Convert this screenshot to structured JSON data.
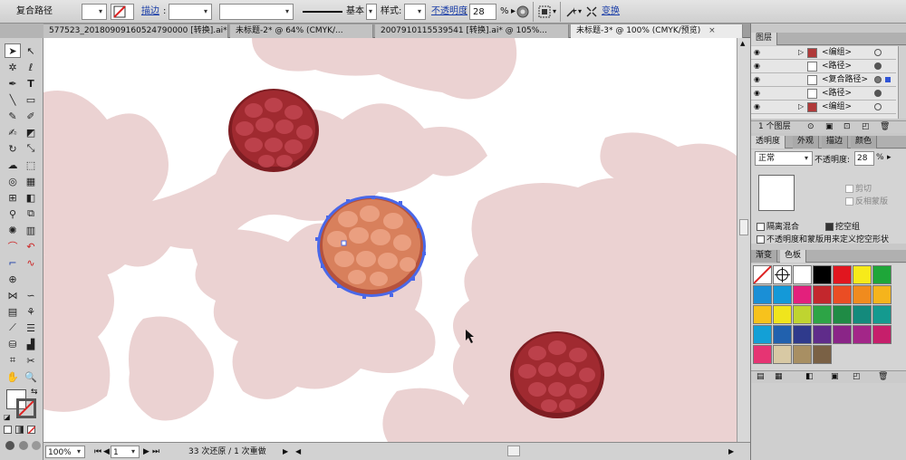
{
  "control_bar": {
    "selection_label": "复合路径",
    "stroke_label": "描边",
    "stroke_style": "基本",
    "style_label": "样式:",
    "opacity_label": "不透明度",
    "opacity_value": "28",
    "opacity_unit": "%",
    "transform_label": "变换"
  },
  "tabs": [
    {
      "label": "577523_20180909160524790000 [转换].ai*",
      "active": false
    },
    {
      "label": "未标题-2* @ 64% (CMYK/...",
      "active": false
    },
    {
      "label": "2007910115539541 [转换].ai* @ 105%...",
      "active": false
    },
    {
      "label": "未标题-3* @ 100% (CMYK/预览)",
      "active": true
    }
  ],
  "status_bar": {
    "zoom": "100%",
    "page": "1",
    "history": "33 次还原 / 1 次重做"
  },
  "layers_panel": {
    "title": "图层",
    "rows": [
      {
        "label": "<编组>",
        "has_arrow": true,
        "thumb": "red"
      },
      {
        "label": "<路径>",
        "has_arrow": false,
        "thumb": "white"
      },
      {
        "label": "<复合路径>",
        "has_arrow": false,
        "thumb": "white"
      },
      {
        "label": "<路径>",
        "has_arrow": false,
        "thumb": "white"
      },
      {
        "label": "<编组>",
        "has_arrow": true,
        "thumb": "red"
      }
    ],
    "footer_count": "1 个图层"
  },
  "transparency_panel": {
    "tabs": [
      "透明度",
      "外观",
      "描边",
      "颜色"
    ],
    "blend_mode": "正常",
    "opacity_label": "不透明度:",
    "opacity_value": "28",
    "opacity_unit": "%",
    "clip_label": "剪切",
    "invert_mask_label": "反相蒙版",
    "isolate_blend_label": "隔离混合",
    "knockout_group_label": "挖空组",
    "opacity_mask_label": "不透明度和蒙版用来定义挖空形状"
  },
  "swatches_panel": {
    "tabs": [
      "渐变",
      "色板"
    ],
    "colors": [
      "#ffffff",
      "#000000",
      "#e1161f",
      "#f7ea1a",
      "#1ea639",
      "#1a8fd6",
      "#1499d8",
      "#e3207c",
      "#c3272d",
      "#ea4d24",
      "#f08b1e",
      "#f5b41c",
      "#f7c21c",
      "#f0e51c",
      "#bfd430",
      "#2da446",
      "#1f8b45",
      "#148a7c",
      "#149a8f",
      "#13a0d6",
      "#2161ae",
      "#2f3a8c",
      "#5f2c8a",
      "#8a2587",
      "#a32688",
      "#c61f6b",
      "#e63473",
      "#d8c9a4",
      "#a88f63",
      "#7a6145"
    ]
  },
  "colors": {
    "silhouette": "#ebd2d2",
    "berry_dark": "#a02a30",
    "berry_selected": "#d8805c",
    "selection_blue": "#4a68e8"
  }
}
